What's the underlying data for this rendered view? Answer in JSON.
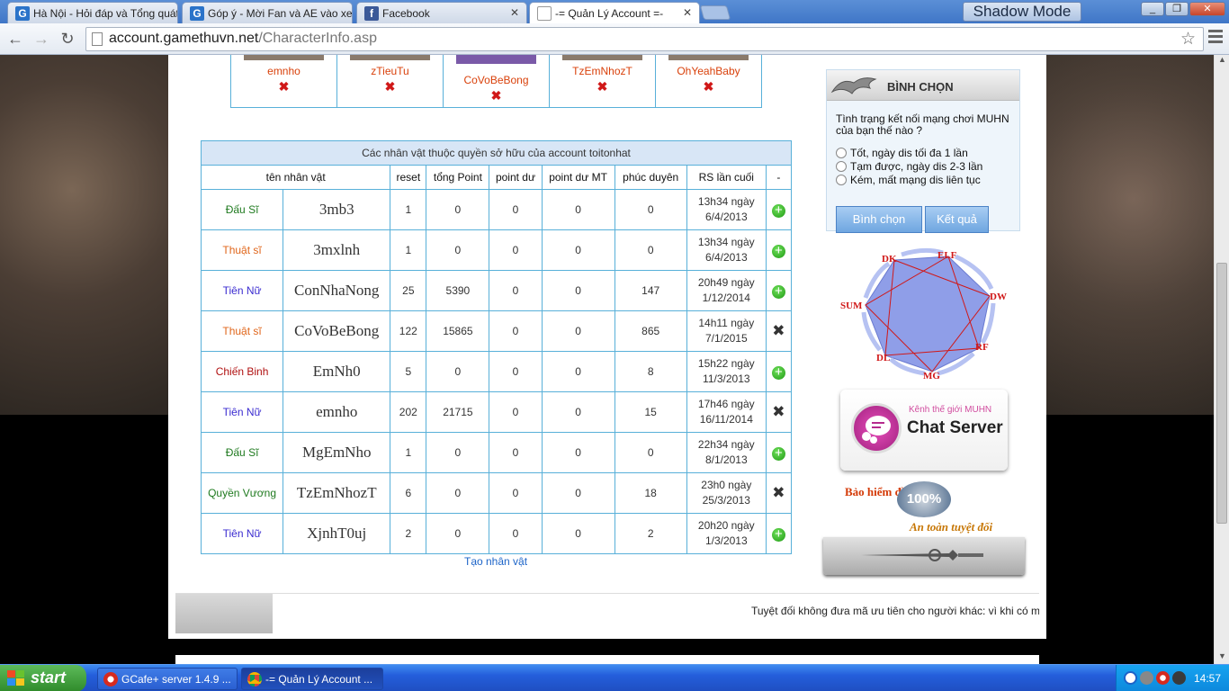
{
  "browser": {
    "tabs": [
      {
        "label": "Hà Nội - Hỏi đáp và Tổng quát",
        "icon": "G",
        "active": false
      },
      {
        "label": "Góp ý - Mời Fan và AE vào xem",
        "icon": "G",
        "active": false
      },
      {
        "label": "Facebook",
        "icon": "f",
        "active": false
      },
      {
        "label": "-= Quản Lý Account =-",
        "icon": "page",
        "active": true
      }
    ],
    "shadow_mode": "Shadow Mode",
    "url_host": "account.gamethuvn.net",
    "url_path": "/CharacterInfo.asp"
  },
  "friends": [
    {
      "name": "emnho"
    },
    {
      "name": "zTieuTu"
    },
    {
      "name": "CoVoBeBong"
    },
    {
      "name": "TzEmNhozT"
    },
    {
      "name": "OhYeahBaby"
    }
  ],
  "delete_glyph": "✖",
  "add_glyph": "+",
  "char_table": {
    "caption": "Các nhân vật thuộc quyền sở hữu của account toitonhat",
    "headers": [
      "tên nhân vật",
      "reset",
      "tổng Point",
      "point dư",
      "point dư MT",
      "phúc duyên",
      "RS lần cuối",
      "-"
    ],
    "rows": [
      {
        "class": "Đấu Sĩ",
        "class_color": "#1f7a1f",
        "name": "3mb3",
        "reset": "1",
        "total": "0",
        "free": "0",
        "free_mt": "0",
        "luck": "0",
        "rs_time": "13h34 ngày",
        "rs_date": "6/4/2013",
        "action": "add"
      },
      {
        "class": "Thuật sĩ",
        "class_color": "#e0661b",
        "name": "3mxlnh",
        "reset": "1",
        "total": "0",
        "free": "0",
        "free_mt": "0",
        "luck": "0",
        "rs_time": "13h34 ngày",
        "rs_date": "6/4/2013",
        "action": "add"
      },
      {
        "class": "Tiên Nữ",
        "class_color": "#3a2bd0",
        "name": "ConNhaNong",
        "reset": "25",
        "total": "5390",
        "free": "0",
        "free_mt": "0",
        "luck": "147",
        "rs_time": "20h49 ngày",
        "rs_date": "1/12/2014",
        "action": "add"
      },
      {
        "class": "Thuật sĩ",
        "class_color": "#e0661b",
        "name": "CoVoBeBong",
        "reset": "122",
        "total": "15865",
        "free": "0",
        "free_mt": "0",
        "luck": "865",
        "rs_time": "14h11 ngày",
        "rs_date": "7/1/2015",
        "action": "del"
      },
      {
        "class": "Chiến Binh",
        "class_color": "#b01010",
        "name": "EmNh0",
        "reset": "5",
        "total": "0",
        "free": "0",
        "free_mt": "0",
        "luck": "8",
        "rs_time": "15h22 ngày",
        "rs_date": "11/3/2013",
        "action": "add"
      },
      {
        "class": "Tiên Nữ",
        "class_color": "#3a2bd0",
        "name": "emnho",
        "reset": "202",
        "total": "21715",
        "free": "0",
        "free_mt": "0",
        "luck": "15",
        "rs_time": "17h46 ngày",
        "rs_date": "16/11/2014",
        "action": "del"
      },
      {
        "class": "Đấu Sĩ",
        "class_color": "#1f7a1f",
        "name": "MgEmNho",
        "reset": "1",
        "total": "0",
        "free": "0",
        "free_mt": "0",
        "luck": "0",
        "rs_time": "22h34 ngày",
        "rs_date": "8/1/2013",
        "action": "add"
      },
      {
        "class": "Quyền Vương",
        "class_color": "#1f7a1f",
        "name": "TzEmNhozT",
        "reset": "6",
        "total": "0",
        "free": "0",
        "free_mt": "0",
        "luck": "18",
        "rs_time": "23h0 ngày",
        "rs_date": "25/3/2013",
        "action": "del"
      },
      {
        "class": "Tiên Nữ",
        "class_color": "#3a2bd0",
        "name": "XjnhT0uj",
        "reset": "2",
        "total": "0",
        "free": "0",
        "free_mt": "0",
        "luck": "2",
        "rs_time": "20h20 ngày",
        "rs_date": "1/3/2013",
        "action": "add"
      }
    ],
    "create_link": "Tạo nhân vật"
  },
  "poll": {
    "title": "BÌNH CHỌN",
    "question": "Tình trạng kết nối mạng chơi MUHN của bạn thế nào ?",
    "options": [
      "Tốt, ngày dis tối đa 1 lần",
      "Tạm được, ngày dis 2-3 lần",
      "Kém, mất mạng dis liên tục"
    ],
    "vote_button": "Bình chọn",
    "result_button": "Kết quả"
  },
  "wheel_labels": [
    "DK",
    "ELF",
    "DW",
    "RF",
    "MG",
    "DL",
    "SUM"
  ],
  "chat_server": {
    "top": "Kênh thế giới MUHN",
    "main": "Chat Server"
  },
  "insurance": {
    "line1": "Bảo hiểm đồ",
    "seal": "100%",
    "line2": "An toàn tuyệt đối"
  },
  "footer": {
    "marquee": "Tuyệt đối không đưa mã ưu tiên cho người khác: vì khi có m"
  },
  "taskbar": {
    "start": "start",
    "items": [
      {
        "label": "GCafe+ server 1.4.9 ...",
        "active": false
      },
      {
        "label": "-= Quản Lý Account ...",
        "active": true
      }
    ],
    "clock": "14:57"
  },
  "colors": {
    "accent_border": "#58b0d9",
    "caption_bg": "#d8e6f6",
    "name_orange": "#d9410b",
    "delete_red": "#d01818"
  }
}
